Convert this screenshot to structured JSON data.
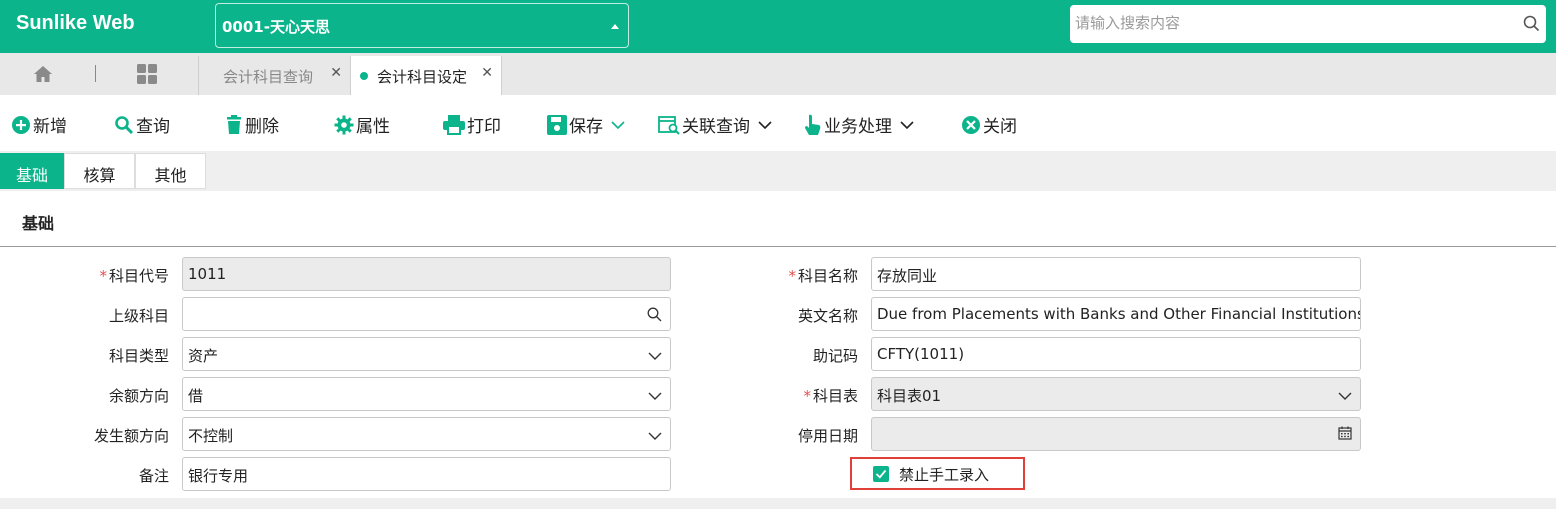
{
  "app": {
    "logo": "Sunlike Web",
    "company": "0001-天心天思",
    "search_placeholder": "请输入搜索内容"
  },
  "tabs": [
    {
      "label": "会计科目查询",
      "active": false
    },
    {
      "label": "会计科目设定",
      "active": true
    }
  ],
  "toolbar": {
    "new": "新增",
    "query": "查询",
    "delete": "删除",
    "props": "属性",
    "print": "打印",
    "save": "保存",
    "related": "关联查询",
    "business": "业务处理",
    "close": "关闭"
  },
  "subtabs": [
    "基础",
    "核算",
    "其他"
  ],
  "section_title": "基础",
  "form": {
    "code": {
      "label": "科目代号",
      "value": "1011",
      "required": true
    },
    "parent": {
      "label": "上级科目",
      "value": ""
    },
    "type": {
      "label": "科目类型",
      "value": "资产"
    },
    "balance_dir": {
      "label": "余额方向",
      "value": "借"
    },
    "amount_dir": {
      "label": "发生额方向",
      "value": "不控制"
    },
    "remark": {
      "label": "备注",
      "value": "银行专用"
    },
    "name": {
      "label": "科目名称",
      "value": "存放同业",
      "required": true
    },
    "english_name": {
      "label": "英文名称",
      "value": "Due from Placements with Banks and Other Financial Institutions"
    },
    "mnemonic": {
      "label": "助记码",
      "value": "CFTY(1011)"
    },
    "account_table": {
      "label": "科目表",
      "value": "科目表01",
      "required": true
    },
    "disable_date": {
      "label": "停用日期",
      "value": ""
    },
    "no_manual_entry": {
      "label": "禁止手工录入",
      "checked": true
    }
  },
  "colors": {
    "brand": "#0bb48a",
    "highlight": "#e0403a"
  }
}
